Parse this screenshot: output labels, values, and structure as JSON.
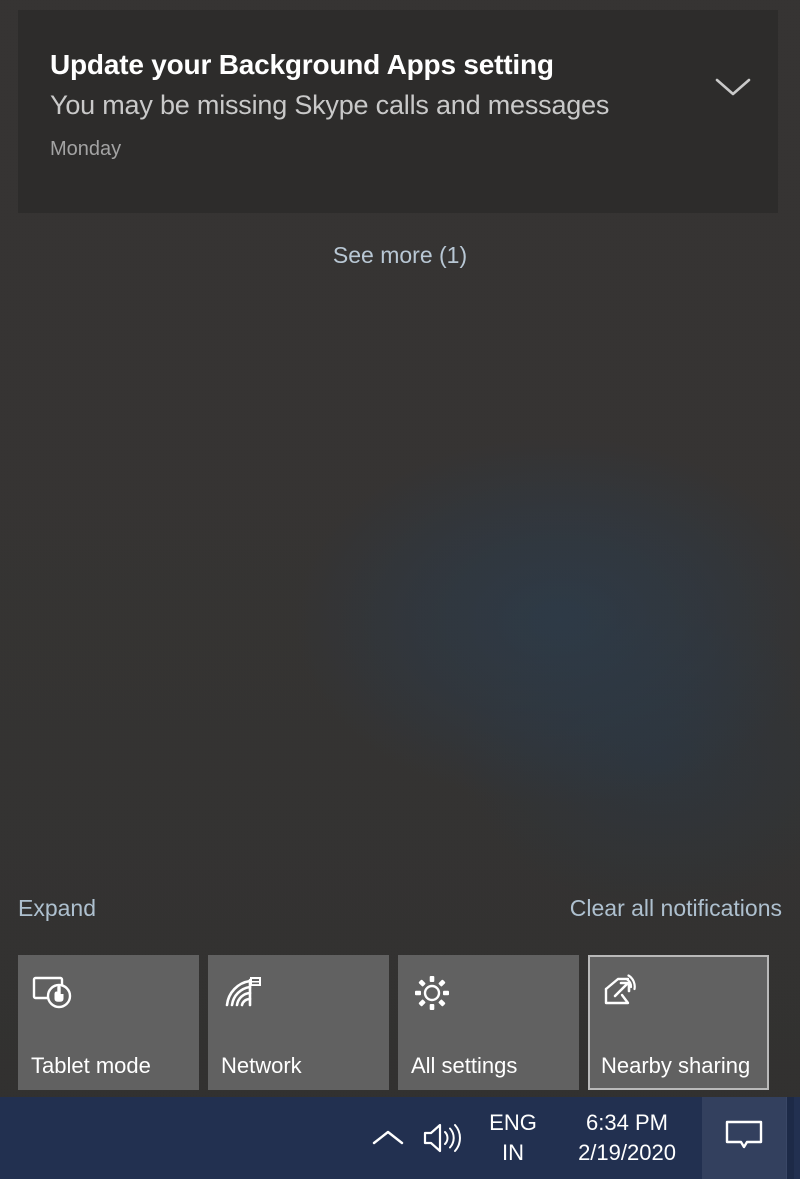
{
  "action_center": {
    "notification": {
      "title": "Update your Background Apps setting",
      "message": "You may be missing Skype calls and messages",
      "timestamp": "Monday",
      "collapse_icon": "chevron-down-icon"
    },
    "see_more_label": "See more (1)",
    "expand_label": "Expand",
    "clear_all_label": "Clear all notifications",
    "quick_actions": [
      {
        "label": "Tablet mode",
        "icon": "tablet-mode-icon",
        "focused": false
      },
      {
        "label": "Network",
        "icon": "network-wifi-icon",
        "focused": false
      },
      {
        "label": "All settings",
        "icon": "gear-icon",
        "focused": false
      },
      {
        "label": "Nearby sharing",
        "icon": "nearby-sharing-icon",
        "focused": true
      }
    ]
  },
  "taskbar": {
    "show_hidden_icons": "chevron-up-icon",
    "volume_icon": "speaker-icon",
    "language": {
      "line1": "ENG",
      "line2": "IN"
    },
    "clock": {
      "time": "6:34 PM",
      "date": "2/19/2020"
    },
    "action_center_icon": "speech-bubble-icon"
  },
  "colors": {
    "panel_background": "#363433",
    "notification_card": "#2d2c2b",
    "tile_background": "#616161",
    "taskbar_background": "#223050",
    "link_text": "#aec0cf",
    "primary_text": "#ffffff"
  }
}
